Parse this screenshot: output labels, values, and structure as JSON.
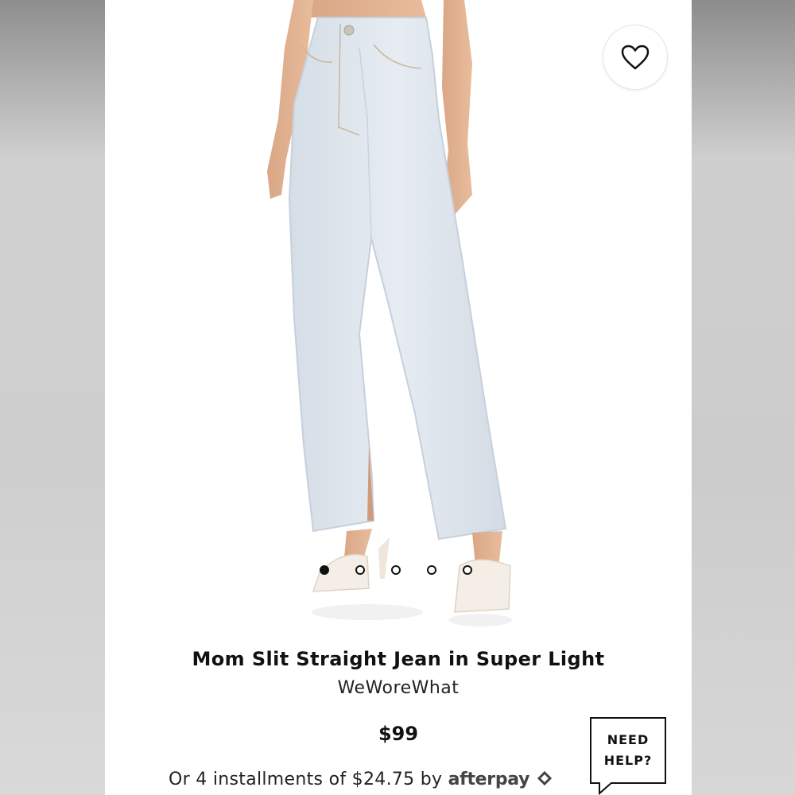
{
  "product": {
    "title": "Mom Slit Straight Jean in Super Light",
    "brand": "WeWoreWhat",
    "price": "$99",
    "installments_text": "Or 4 installments of $24.75 by ",
    "afterpay_label": "afterpay"
  },
  "carousel": {
    "total_slides": 5,
    "active_index": 0
  },
  "help": {
    "line1": "NEED",
    "line2": "HELP?"
  },
  "icons": {
    "wishlist": "heart-icon",
    "afterpay": "afterpay-logo-icon",
    "help": "chat-bubble-icon"
  },
  "colors": {
    "denim": "#dfe6ee",
    "text": "#111111",
    "accent": "#000000"
  }
}
